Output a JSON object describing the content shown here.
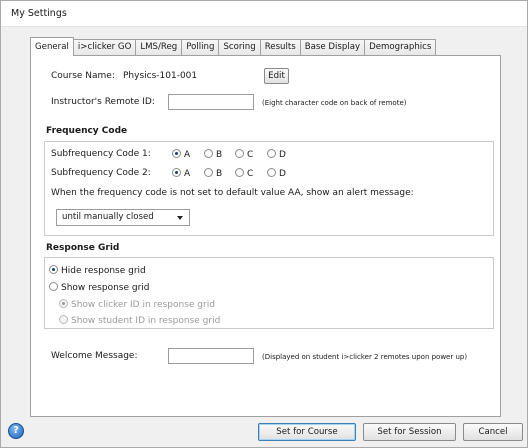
{
  "window": {
    "title": "My Settings"
  },
  "tabs": [
    {
      "label": "General",
      "active": true
    },
    {
      "label": "i>clicker GO",
      "active": false
    },
    {
      "label": "LMS/Reg",
      "active": false
    },
    {
      "label": "Polling",
      "active": false
    },
    {
      "label": "Scoring",
      "active": false
    },
    {
      "label": "Results",
      "active": false
    },
    {
      "label": "Base Display",
      "active": false
    },
    {
      "label": "Demographics",
      "active": false
    }
  ],
  "general": {
    "course_name_label": "Course Name:",
    "course_name_value": "Physics-101-001",
    "edit_label": "Edit",
    "remote_id_label": "Instructor's Remote ID:",
    "remote_id_value": "",
    "remote_id_hint": "(Eight character code on back of remote)"
  },
  "frequency": {
    "title": "Frequency Code",
    "sub1_label": "Subfrequency Code 1:",
    "sub2_label": "Subfrequency Code 2:",
    "options": [
      "A",
      "B",
      "C",
      "D"
    ],
    "sub1_selected": "A",
    "sub2_selected": "A",
    "alert_text": "When the frequency code is not set to default value AA, show an alert message:",
    "alert_select_value": "until manually closed"
  },
  "response_grid": {
    "title": "Response Grid",
    "hide_label": "Hide response grid",
    "show_label": "Show response grid",
    "show_clicker_label": "Show clicker ID in response grid",
    "show_student_label": "Show student ID in response grid",
    "selected": "hide"
  },
  "welcome": {
    "label": "Welcome Message:",
    "value": "",
    "hint": "(Displayed on student i>clicker 2 remotes upon power up)"
  },
  "footer": {
    "help_glyph": "?",
    "set_course_label": "Set for Course",
    "set_session_label": "Set for Session",
    "cancel_label": "Cancel"
  },
  "colors": {
    "accent": "#1e63b8",
    "panel_bg": "#ffffff",
    "window_bg": "#f0f0f0"
  }
}
